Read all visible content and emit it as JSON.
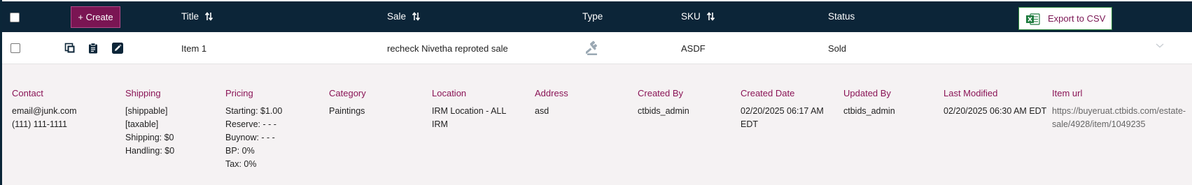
{
  "header": {
    "create_label": "+ Create",
    "columns": {
      "title": "Title",
      "sale": "Sale",
      "type": "Type",
      "sku": "SKU",
      "status": "Status"
    },
    "export_label": "Export to CSV"
  },
  "row": {
    "title": "Item 1",
    "sale": "recheck Nivetha reproted sale",
    "type_icon": "gavel-icon",
    "sku": "ASDF",
    "status": "Sold"
  },
  "details": {
    "contact": {
      "label": "Contact",
      "lines": [
        "email@junk.com",
        "(111) 111-1111"
      ]
    },
    "shipping": {
      "label": "Shipping",
      "lines": [
        "[shippable]",
        "[taxable]",
        "Shipping: $0",
        "Handling: $0"
      ]
    },
    "pricing": {
      "label": "Pricing",
      "lines": [
        "Starting: $1.00",
        "Reserve: - - -",
        "Buynow: - - -",
        "BP: 0%",
        "Tax: 0%"
      ]
    },
    "category": {
      "label": "Category",
      "lines": [
        "Paintings"
      ]
    },
    "location": {
      "label": "Location",
      "lines": [
        "IRM Location - ALL",
        "IRM"
      ]
    },
    "address": {
      "label": "Address",
      "lines": [
        "asd"
      ]
    },
    "created_by": {
      "label": "Created By",
      "lines": [
        "ctbids_admin"
      ]
    },
    "created_date": {
      "label": "Created Date",
      "lines": [
        "02/20/2025 06:17 AM",
        "EDT"
      ]
    },
    "updated_by": {
      "label": "Updated By",
      "lines": [
        "ctbids_admin"
      ]
    },
    "last_modified": {
      "label": "Last Modified",
      "lines": [
        "02/20/2025 06:30 AM EDT"
      ]
    },
    "item_url": {
      "label": "Item url",
      "lines": [
        "https://buyeruat.ctbids.com/estate-",
        "sale/4928/item/1049235"
      ]
    }
  },
  "colors": {
    "header_bg": "#0c2538",
    "accent": "#7a1553",
    "panel_bg": "#f5f2f3",
    "excel_green": "#1e7b3e"
  }
}
